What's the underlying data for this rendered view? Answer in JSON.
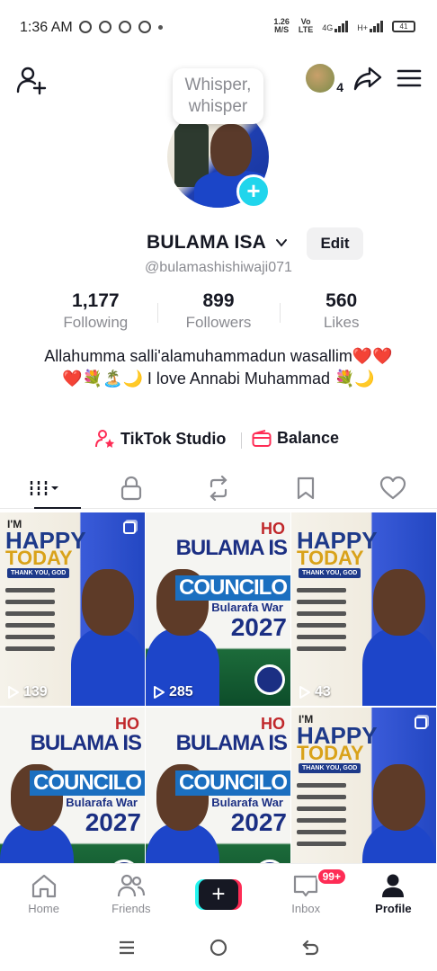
{
  "status_bar": {
    "time": "1:36 AM",
    "speed_value": "1.26",
    "speed_unit": "M/S",
    "volte_top": "Vo",
    "volte_bottom": "LTE",
    "network": "4G",
    "network2": "H+",
    "battery": "41"
  },
  "header": {
    "tooltip": "Whisper, whisper",
    "friends_count": "4"
  },
  "profile": {
    "display_name": "BULAMA ISA",
    "edit_label": "Edit",
    "handle": "@bulamashishiwaji071",
    "stats": [
      {
        "value": "1,177",
        "label": "Following"
      },
      {
        "value": "899",
        "label": "Followers"
      },
      {
        "value": "560",
        "label": "Likes"
      }
    ],
    "bio": "Allahumma salli'alamuhammadun wasallim❤️❤️❤️💐🏝️🌙 I love Annabi Muhammad 💐🌙"
  },
  "links": {
    "studio": "TikTok Studio",
    "balance": "Balance"
  },
  "videos": [
    {
      "type": "happy",
      "views": "139",
      "multi": true,
      "text": {
        "im": "I'M",
        "w1": "HAPPY",
        "w2": "TODAY",
        "tag": "THANK YOU, GOD"
      }
    },
    {
      "type": "council",
      "views": "285",
      "multi": false,
      "text": {
        "hol": "HO",
        "nm": "BULAMA IS",
        "cn": "COUNCILO",
        "br": "Bularafa War",
        "yr": "2027"
      }
    },
    {
      "type": "happy",
      "views": "43",
      "multi": false,
      "text": {
        "im": "",
        "w1": "HAPPY",
        "w2": "TODAY",
        "tag": "THANK YOU, GOD"
      }
    },
    {
      "type": "council",
      "views": "",
      "multi": false,
      "text": {
        "hol": "HO",
        "nm": "BULAMA IS",
        "cn": "COUNCILO",
        "br": "Bularafa War",
        "yr": "2027"
      }
    },
    {
      "type": "council",
      "views": "",
      "multi": false,
      "text": {
        "hol": "HO",
        "nm": "BULAMA IS",
        "cn": "COUNCILO",
        "br": "Bularafa War",
        "yr": "2027"
      }
    },
    {
      "type": "happy",
      "views": "",
      "multi": true,
      "text": {
        "im": "I'M",
        "w1": "HAPPY",
        "w2": "TODAY",
        "tag": "THANK YOU, GOD"
      }
    }
  ],
  "bottom_nav": {
    "home": "Home",
    "friends": "Friends",
    "create": "+",
    "inbox": "Inbox",
    "inbox_badge": "99+",
    "profile": "Profile"
  },
  "colors": {
    "accent_cyan": "#20d5ec",
    "accent_red": "#fe2c55",
    "text_primary": "#161823",
    "text_secondary": "#8a8b91"
  }
}
